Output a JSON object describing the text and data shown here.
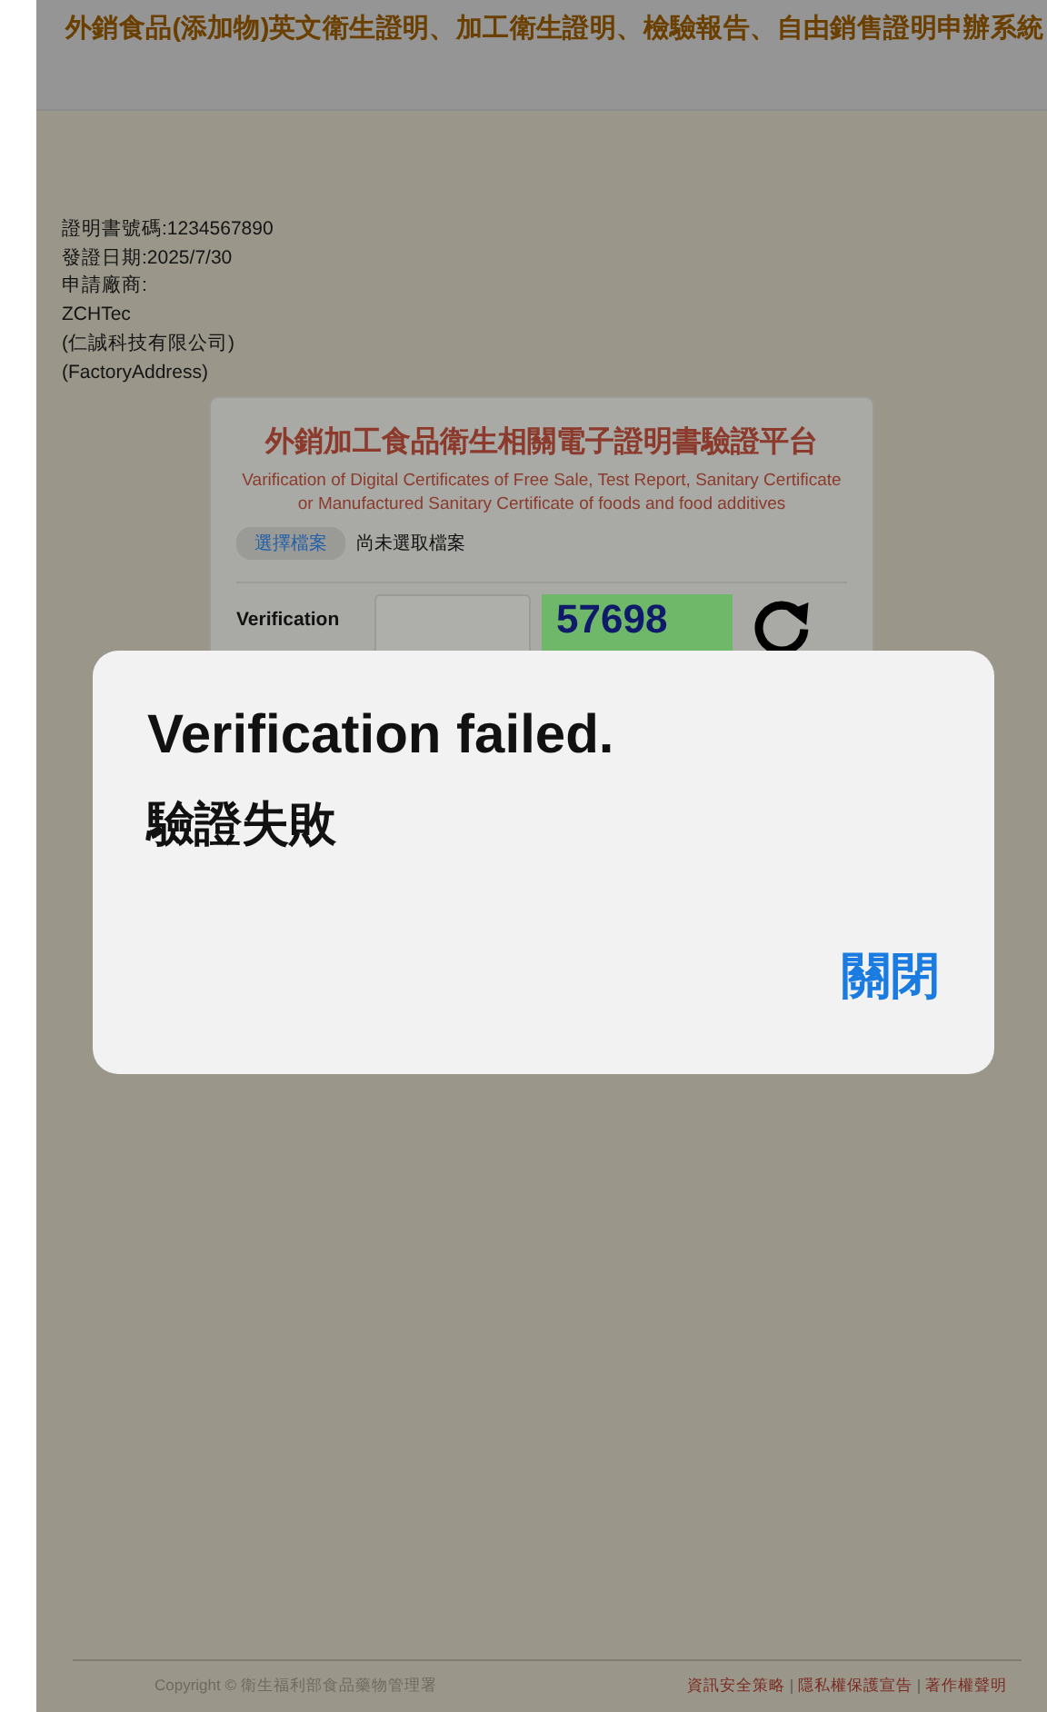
{
  "banner": {
    "title": "外銷食品(添加物)英文衛生證明、加工衛生證明、檢驗報告、自由銷售證明申辦系統"
  },
  "certificate_info": [
    "證明書號碼:1234567890",
    "發證日期:2025/7/30",
    "申請廠商:",
    "ZCHTec",
    "(仁誠科技有限公司)",
    "(FactoryAddress)"
  ],
  "verify_card": {
    "title": "外銷加工食品衛生相關電子證明書驗證平台",
    "subtitle": "Varification of Digital Certificates of Free Sale, Test Report, Sanitary Certificate or Manufactured Sanitary Certificate of foods and food additives",
    "file_button": "選擇檔案",
    "file_status": "尚未選取檔案",
    "verification_label": "Verification",
    "captcha": "57698"
  },
  "footer": {
    "copyright": "Copyright © 衛生福利部食品藥物管理署",
    "links": [
      "資訊安全策略",
      "隱私權保護宣告",
      "著作權聲明"
    ]
  },
  "dialog": {
    "title": "Verification failed.",
    "message": "驗證失敗",
    "button": "關閉"
  }
}
